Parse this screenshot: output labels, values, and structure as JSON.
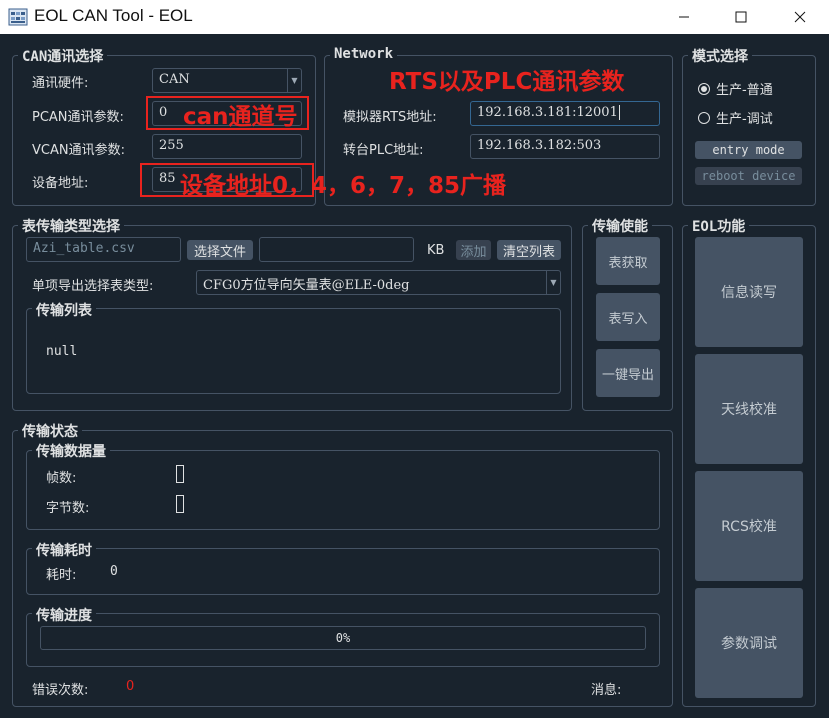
{
  "window": {
    "title": "EOL CAN Tool - EOL",
    "icon": "app-grid-icon"
  },
  "can_group": {
    "title": "CAN通讯选择",
    "hardware_label": "通讯硬件:",
    "hardware_value": "CAN",
    "pcan_label": "PCAN通讯参数:",
    "pcan_value": "0",
    "vcan_label": "VCAN通讯参数:",
    "vcan_value": "255",
    "device_label": "设备地址:",
    "device_value": "85"
  },
  "network_group": {
    "title": "Network",
    "rts_label": "模拟器RTS地址:",
    "rts_value": "192.168.3.181:12001",
    "plc_label": "转台PLC地址:",
    "plc_value": "192.168.3.182:503"
  },
  "mode_group": {
    "title": "模式选择",
    "option_normal": "生产-普通",
    "option_debug": "生产-调试",
    "selected": "option_normal",
    "entry_mode": "entry mode",
    "reboot_device": "reboot device"
  },
  "table_group": {
    "title": "表传输类型选择",
    "file_placeholder": "Azi_table.csv",
    "choose_file": "选择文件",
    "size_value": "",
    "size_unit": "KB",
    "add": "添加",
    "clear_list": "清空列表",
    "export_label": "单项导出选择表类型:",
    "export_value": "CFG0方位导向矢量表@ELE-0deg",
    "list_title": "传输列表",
    "list_items": [
      "null"
    ]
  },
  "transfer_enable": {
    "title": "传输使能",
    "get_table": "表获取",
    "write_table": "表写入",
    "one_click_export": "一键导出"
  },
  "eol_group": {
    "title": "EOL功能",
    "info_rw": "信息读写",
    "antenna_cal": "天线校准",
    "rcs_cal": "RCS校准",
    "param_debug": "参数调试"
  },
  "status_group": {
    "title": "传输状态",
    "data_title": "传输数据量",
    "frames_label": "帧数:",
    "bytes_label": "字节数:",
    "time_title": "传输耗时",
    "time_label": "耗时:",
    "time_value": "0",
    "progress_title": "传输进度",
    "progress_text": "0%",
    "progress_value": 0,
    "error_label": "错误次数:",
    "error_value": "0",
    "message_label": "消息:"
  },
  "annotations": {
    "can_channel": "can通道号",
    "device_addr": "设备地址0，4，6，7，85广播",
    "rts_plc": "RTS以及PLC通讯参数"
  },
  "colors": {
    "background": "#19232d",
    "border": "#455364",
    "button": "#455364",
    "annotation_red": "#e8231e",
    "error_red": "#e8231e",
    "focus_blue": "#346792"
  }
}
